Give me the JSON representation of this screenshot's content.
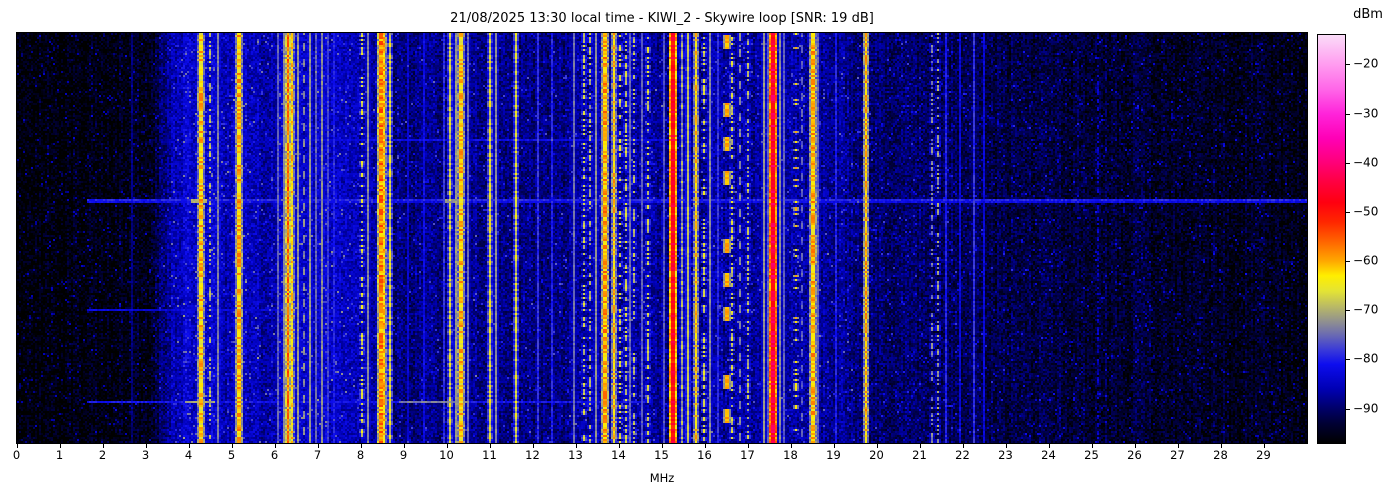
{
  "figure": {
    "datetime": "21/08/2025 13:30",
    "time_ref": "local time",
    "station": "KIWI_2",
    "antenna": "Skywire loop",
    "snr": "19 dB"
  },
  "chart_data": {
    "type": "heatmap",
    "subtype": "radio-spectrogram-waterfall",
    "title": "21/08/2025 13:30 local time - KIWI_2 - Skywire loop [SNR: 19 dB]",
    "xlabel": "MHz",
    "x_range_mhz": [
      0,
      30
    ],
    "x_ticks": [
      0,
      1,
      2,
      3,
      4,
      5,
      6,
      7,
      8,
      9,
      10,
      11,
      12,
      13,
      14,
      15,
      16,
      17,
      18,
      19,
      20,
      21,
      22,
      23,
      24,
      25,
      26,
      27,
      28,
      29
    ],
    "grid": false,
    "legend": "none",
    "colorbar": {
      "label": "dBm",
      "ticks": [
        -20,
        -30,
        -40,
        -50,
        -60,
        -70,
        -80,
        -90
      ],
      "tick_labels": [
        "−20",
        "−30",
        "−40",
        "−50",
        "−60",
        "−70",
        "−80",
        "−90"
      ],
      "value_range_dbm": [
        -97,
        -14
      ],
      "stops": [
        {
          "v": -97,
          "c": "#000000"
        },
        {
          "v": -93,
          "c": "#000034"
        },
        {
          "v": -90,
          "c": "#000068"
        },
        {
          "v": -86,
          "c": "#0000b4"
        },
        {
          "v": -81,
          "c": "#0d0dee"
        },
        {
          "v": -78,
          "c": "#3b3bd8"
        },
        {
          "v": -75,
          "c": "#6a6ab2"
        },
        {
          "v": -72,
          "c": "#94948c"
        },
        {
          "v": -69,
          "c": "#bcbc62"
        },
        {
          "v": -66,
          "c": "#e4e434"
        },
        {
          "v": -63,
          "c": "#ffee00"
        },
        {
          "v": -60,
          "c": "#ffa800"
        },
        {
          "v": -56,
          "c": "#ff6400"
        },
        {
          "v": -52,
          "c": "#ff2600"
        },
        {
          "v": -48,
          "c": "#ff0010"
        },
        {
          "v": -44,
          "c": "#ff0040"
        },
        {
          "v": -40,
          "c": "#ff0078"
        },
        {
          "v": -35,
          "c": "#ff00b6"
        },
        {
          "v": -30,
          "c": "#ff24da"
        },
        {
          "v": -25,
          "c": "#ff66e8"
        },
        {
          "v": -20,
          "c": "#ff9cf0"
        },
        {
          "v": -14,
          "c": "#fadcf8"
        }
      ]
    },
    "noise_floor_dbm": [
      [
        0,
        -96.5
      ],
      [
        1.2,
        -96
      ],
      [
        2.2,
        -95
      ],
      [
        3.1,
        -94
      ],
      [
        3.4,
        -89
      ],
      [
        3.7,
        -85
      ],
      [
        4.0,
        -83.5
      ],
      [
        4.6,
        -83.5
      ],
      [
        4.85,
        -85.5
      ],
      [
        5.1,
        -84.5
      ],
      [
        5.55,
        -85
      ],
      [
        5.8,
        -87
      ],
      [
        6.05,
        -85
      ],
      [
        6.6,
        -84.5
      ],
      [
        7.5,
        -84
      ],
      [
        7.9,
        -85.5
      ],
      [
        8.3,
        -87
      ],
      [
        8.7,
        -88.5
      ],
      [
        10.3,
        -88
      ],
      [
        11.0,
        -87.5
      ],
      [
        11.5,
        -88.5
      ],
      [
        12.5,
        -88.5
      ],
      [
        13.1,
        -87.5
      ],
      [
        13.5,
        -86.5
      ],
      [
        14.6,
        -86.5
      ],
      [
        15.2,
        -87.5
      ],
      [
        16.0,
        -87
      ],
      [
        18.3,
        -86.5
      ],
      [
        19.2,
        -87.5
      ],
      [
        20.0,
        -89.5
      ],
      [
        21.0,
        -90
      ],
      [
        22.0,
        -90.5
      ],
      [
        22.6,
        -91.5
      ],
      [
        24.0,
        -92
      ],
      [
        26.0,
        -93
      ],
      [
        28.0,
        -94
      ],
      [
        30.0,
        -95
      ]
    ],
    "signals_format": [
      "freq_mhz",
      "peak_dbm",
      "style",
      "width_bins"
    ],
    "signals": [
      [
        2.66,
        -89,
        "solid",
        1
      ],
      [
        4.25,
        -62,
        "flicker",
        2
      ],
      [
        4.47,
        -70,
        "dots",
        1
      ],
      [
        4.65,
        -74,
        "solid",
        1
      ],
      [
        5.16,
        -61,
        "flicker",
        2
      ],
      [
        6.05,
        -76,
        "solid",
        1
      ],
      [
        6.19,
        -73,
        "solid",
        1
      ],
      [
        6.3,
        -57,
        "flicker",
        1
      ],
      [
        6.38,
        -63,
        "flicker",
        1
      ],
      [
        6.52,
        -72,
        "solid",
        1
      ],
      [
        6.64,
        -73,
        "dash",
        1
      ],
      [
        6.8,
        -72,
        "solid",
        1
      ],
      [
        6.95,
        -76,
        "solid",
        1
      ],
      [
        7.05,
        -73,
        "solid",
        1
      ],
      [
        7.2,
        -78,
        "solid",
        1
      ],
      [
        7.35,
        -80,
        "solid",
        1
      ],
      [
        8.0,
        -67,
        "dots",
        1
      ],
      [
        8.12,
        -73,
        "solid",
        1
      ],
      [
        8.42,
        -58,
        "flicker",
        2
      ],
      [
        8.52,
        -62,
        "flicker",
        1
      ],
      [
        8.67,
        -67,
        "flicker",
        1
      ],
      [
        9.05,
        -84,
        "solid",
        1
      ],
      [
        9.45,
        -82,
        "solid",
        1
      ],
      [
        9.9,
        -79,
        "solid",
        1
      ],
      [
        10.05,
        -68,
        "flicker",
        1
      ],
      [
        10.17,
        -72,
        "solid",
        1
      ],
      [
        10.32,
        -62,
        "flicker",
        2
      ],
      [
        10.45,
        -75,
        "solid",
        1
      ],
      [
        11.0,
        -67,
        "flicker",
        1
      ],
      [
        11.12,
        -73,
        "solid",
        1
      ],
      [
        11.57,
        -68,
        "flicker",
        1
      ],
      [
        12.1,
        -79,
        "solid",
        1
      ],
      [
        12.42,
        -80,
        "solid",
        1
      ],
      [
        12.95,
        -75,
        "solid",
        1
      ],
      [
        13.15,
        -68,
        "dots",
        1
      ],
      [
        13.28,
        -70,
        "dots",
        1
      ],
      [
        13.42,
        -73,
        "solid",
        1
      ],
      [
        13.66,
        -60,
        "flicker",
        2
      ],
      [
        13.88,
        -62,
        "flicker",
        1
      ],
      [
        14.0,
        -67,
        "dots",
        1
      ],
      [
        14.12,
        -68,
        "dots",
        1
      ],
      [
        14.23,
        -75,
        "solid",
        1
      ],
      [
        14.34,
        -70,
        "dots",
        1
      ],
      [
        14.5,
        -76,
        "solid",
        1
      ],
      [
        14.66,
        -68,
        "dots",
        1
      ],
      [
        15.03,
        -77,
        "solid",
        1
      ],
      [
        15.21,
        -48,
        "flicker",
        2
      ],
      [
        15.42,
        -72,
        "flicker",
        1
      ],
      [
        15.6,
        -69,
        "solid",
        1
      ],
      [
        15.77,
        -63,
        "flicker",
        1
      ],
      [
        15.95,
        -67,
        "dots",
        1
      ],
      [
        16.08,
        -73,
        "solid",
        1
      ],
      [
        16.28,
        -79,
        "solid",
        1
      ],
      [
        16.47,
        -60,
        "longdash",
        2
      ],
      [
        16.62,
        -68,
        "dots",
        1
      ],
      [
        16.8,
        -73,
        "dash",
        1
      ],
      [
        16.98,
        -70,
        "dots",
        1
      ],
      [
        17.35,
        -72,
        "solid",
        1
      ],
      [
        17.44,
        -76,
        "solid",
        1
      ],
      [
        17.58,
        -45,
        "flicker",
        2
      ],
      [
        17.72,
        -73,
        "solid",
        1
      ],
      [
        17.82,
        -76,
        "solid",
        1
      ],
      [
        18.09,
        -62,
        "sparse",
        1
      ],
      [
        18.21,
        -76,
        "dash",
        1
      ],
      [
        18.5,
        -61,
        "flicker",
        2
      ],
      [
        18.62,
        -76,
        "solid",
        1
      ],
      [
        19.02,
        -80,
        "solid",
        1
      ],
      [
        19.73,
        -61,
        "flicker",
        1
      ],
      [
        21.25,
        -74,
        "dots",
        1
      ],
      [
        21.4,
        -72,
        "dots",
        1
      ],
      [
        21.6,
        -80,
        "solid",
        1
      ],
      [
        21.9,
        -83,
        "solid",
        1
      ],
      [
        22.25,
        -79,
        "solid",
        1
      ],
      [
        22.45,
        -83,
        "solid",
        1
      ],
      [
        25.1,
        -85,
        "dots",
        1
      ]
    ],
    "time_events_format": [
      "t_frac_from_top",
      "from_mhz",
      "to_mhz",
      "dbm"
    ],
    "time_events": [
      {
        "t": 0.262,
        "f0": 5.85,
        "f1": 15.3,
        "p": -82,
        "rows": 1,
        "hot": []
      },
      {
        "t": 0.407,
        "f0": 1.65,
        "f1": 29.97,
        "p": -80,
        "rows": 2,
        "hot": [
          {
            "f0": 4.05,
            "f1": 4.4,
            "p": -70
          },
          {
            "f0": 9.95,
            "f1": 10.4,
            "p": -72
          }
        ]
      },
      {
        "t": 0.675,
        "f0": 1.65,
        "f1": 7.3,
        "p": -83,
        "rows": 1,
        "hot": []
      },
      {
        "t": 0.9,
        "f0": 1.65,
        "f1": 14.6,
        "p": -81,
        "rows": 1,
        "hot": [
          {
            "f0": 3.9,
            "f1": 4.6,
            "p": -71
          },
          {
            "f0": 8.9,
            "f1": 10.5,
            "p": -74
          }
        ]
      }
    ]
  }
}
